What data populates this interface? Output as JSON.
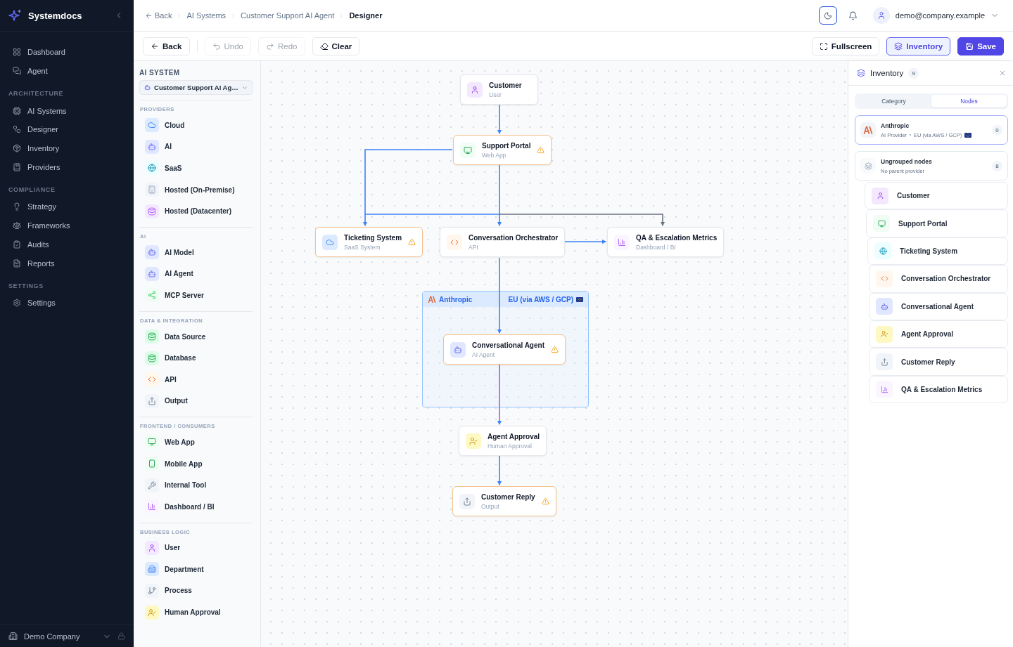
{
  "sidebar": {
    "brand": "Systemdocs",
    "sections": [
      {
        "items": [
          {
            "label": "Dashboard",
            "kind": "grid"
          },
          {
            "label": "Agent",
            "kind": "chat"
          }
        ]
      },
      {
        "title": "ARCHITECTURE",
        "items": [
          {
            "label": "AI Systems",
            "kind": "chip"
          },
          {
            "label": "Designer",
            "kind": "flow"
          },
          {
            "label": "Inventory",
            "kind": "package"
          },
          {
            "label": "Providers",
            "kind": "book"
          }
        ]
      },
      {
        "title": "COMPLIANCE",
        "items": [
          {
            "label": "Strategy",
            "kind": "bulb"
          },
          {
            "label": "Frameworks",
            "kind": "scale"
          },
          {
            "label": "Audits",
            "kind": "clipboard"
          },
          {
            "label": "Reports",
            "kind": "file"
          }
        ]
      },
      {
        "title": "SETTINGS",
        "items": [
          {
            "label": "Settings",
            "kind": "gear"
          }
        ]
      }
    ],
    "footer": {
      "company": "Demo Company"
    }
  },
  "topbar": {
    "breadcrumbs": [
      {
        "label": "Back",
        "kind": "back"
      },
      {
        "label": "AI Systems",
        "kind": "link"
      },
      {
        "label": "Customer Support AI Agent",
        "kind": "link"
      },
      {
        "label": "Designer",
        "kind": "current"
      }
    ],
    "user": {
      "email": "demo@company.example"
    }
  },
  "toolbar": {
    "left": [
      {
        "label": "Back",
        "kind": "back",
        "disabled": false
      },
      {
        "label": "Undo",
        "kind": "undo",
        "disabled": true
      },
      {
        "label": "Redo",
        "kind": "redo",
        "disabled": true
      },
      {
        "label": "Clear",
        "kind": "clear",
        "disabled": false
      }
    ],
    "right": [
      {
        "label": "Fullscreen",
        "kind": "fullscreen"
      },
      {
        "label": "Inventory",
        "kind": "inventory"
      },
      {
        "label": "Save",
        "kind": "save"
      }
    ]
  },
  "palette": {
    "label": "AI SYSTEM",
    "system": "Customer Support AI Ag…",
    "sections": [
      {
        "title": "PROVIDERS",
        "items": [
          {
            "label": "Cloud",
            "kind": "cloud"
          },
          {
            "label": "AI",
            "kind": "ai"
          },
          {
            "label": "SaaS",
            "kind": "saas"
          },
          {
            "label": "Hosted (On-Premise)",
            "kind": "onprem"
          },
          {
            "label": "Hosted (Datacenter)",
            "kind": "datacenter"
          }
        ]
      },
      {
        "title": "AI",
        "items": [
          {
            "label": "AI Model",
            "kind": "ai"
          },
          {
            "label": "AI Agent",
            "kind": "agent"
          },
          {
            "label": "MCP Server",
            "kind": "mcp"
          }
        ]
      },
      {
        "title": "DATA & INTEGRATION",
        "items": [
          {
            "label": "Data Source",
            "kind": "datasource"
          },
          {
            "label": "Database",
            "kind": "database"
          },
          {
            "label": "API",
            "kind": "api"
          },
          {
            "label": "Output",
            "kind": "output"
          }
        ]
      },
      {
        "title": "FRONTEND / CONSUMERS",
        "items": [
          {
            "label": "Web App",
            "kind": "webapp"
          },
          {
            "label": "Mobile App",
            "kind": "mobile"
          },
          {
            "label": "Internal Tool",
            "kind": "tool"
          },
          {
            "label": "Dashboard / BI",
            "kind": "dashboard"
          }
        ]
      },
      {
        "title": "BUSINESS LOGIC",
        "items": [
          {
            "label": "User",
            "kind": "user"
          },
          {
            "label": "Department",
            "kind": "department"
          },
          {
            "label": "Process",
            "kind": "process"
          },
          {
            "label": "Human Approval",
            "kind": "approval"
          }
        ]
      }
    ]
  },
  "canvas": {
    "group": {
      "name": "Anthropic",
      "region": "EU (via AWS / GCP)"
    },
    "nodes": [
      {
        "title": "Customer",
        "subtitle": "User",
        "kind": "user",
        "warning": false
      },
      {
        "title": "Support Portal",
        "subtitle": "Web App",
        "kind": "webapp",
        "warning": true
      },
      {
        "title": "Ticketing System",
        "subtitle": "SaaS System",
        "kind": "cloud",
        "warning": true
      },
      {
        "title": "Conversation Orchestrator",
        "subtitle": "API",
        "kind": "api",
        "warning": false
      },
      {
        "title": "QA & Escalation Metrics",
        "subtitle": "Dashboard / BI",
        "kind": "dashboard",
        "warning": false
      },
      {
        "title": "Conversational Agent",
        "subtitle": "AI Agent",
        "kind": "agent",
        "warning": true
      },
      {
        "title": "Agent Approval",
        "subtitle": "Human Approval",
        "kind": "approval",
        "warning": false
      },
      {
        "title": "Customer Reply",
        "subtitle": "Output",
        "kind": "output",
        "warning": true
      }
    ]
  },
  "inventory": {
    "title": "Inventory",
    "count": "9",
    "tabs": [
      {
        "label": "Category",
        "selected": false
      },
      {
        "label": "Nodes",
        "selected": true
      }
    ],
    "groups": [
      {
        "name": "Anthropic",
        "kind": "provider",
        "meta": "AI Provider",
        "region": "EU (via AWS / GCP)",
        "count": "0",
        "highlighted": true
      },
      {
        "name": "Ungrouped nodes",
        "kind": "ungrouped",
        "meta": "No parent provider",
        "count": "8",
        "highlighted": false,
        "children": [
          {
            "label": "Customer",
            "kind": "user"
          },
          {
            "label": "Support Portal",
            "kind": "webapp"
          },
          {
            "label": "Ticketing System",
            "kind": "saas"
          },
          {
            "label": "Conversation Orchestrator",
            "kind": "api"
          },
          {
            "label": "Conversational Agent",
            "kind": "agent"
          },
          {
            "label": "Agent Approval",
            "kind": "approval"
          },
          {
            "label": "Customer Reply",
            "kind": "output"
          },
          {
            "label": "QA & Escalation Metrics",
            "kind": "dashboard"
          }
        ]
      }
    ]
  }
}
